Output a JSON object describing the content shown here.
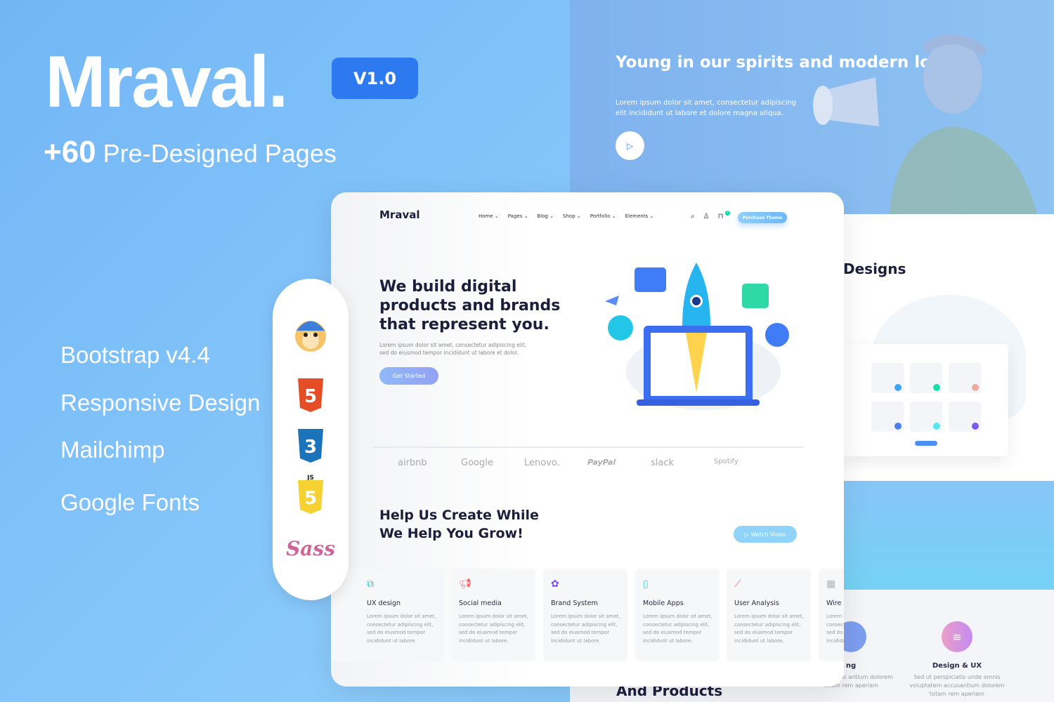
{
  "promo": {
    "title": "Mraval.",
    "version": "V1.0",
    "pages_count": "+60",
    "pages_label": "Pre-Designed Pages",
    "features": [
      "Bootstrap v4.4",
      "Responsive Design",
      "Mailchimp",
      "Google Fonts"
    ],
    "tech_icons": [
      "mailchimp-icon",
      "html5-icon",
      "css3-icon",
      "javascript-icon",
      "sass-icon"
    ],
    "sass_text": "Sass",
    "js_text": "JS"
  },
  "hero_right": {
    "title": "Young in our spirits and modern look.",
    "text": "Lorem ipsum dolor sit amet, consectetur adipiscing elit incididunt ut labore et dolore magna aliqua."
  },
  "designs_panel": {
    "title": "Designs",
    "dot_colors": [
      "#3fa2f7",
      "#18dfa9",
      "#f0a8a0",
      "#4d7df2",
      "#55e6f0",
      "#7b5af0"
    ]
  },
  "products": {
    "title": "And Products",
    "services": [
      {
        "title": "ng",
        "text": "s unde omnis\nantium dolorem\ntotam rem aperiam",
        "color": "#7d9ef0"
      },
      {
        "title": "Design & UX",
        "text": "Sed ut perspiciatis unde omnis voluptatem accusantium dolorem totam rem aperiam",
        "color": "#d18de0"
      }
    ]
  },
  "site": {
    "logo": "Mraval",
    "nav": [
      "Home",
      "Pages",
      "Blog",
      "Shop",
      "Portfolio",
      "Elements"
    ],
    "cart_count": "2",
    "purchase": "Purchase Theme",
    "hero_title": "We build digital products and brands that represent you.",
    "hero_text": "Lorem ipsum dolor sit amet, consectetur adipiscing elit, sed do eiusmod tempor incididunt ut labore et dolor.",
    "cta": "Get Started",
    "brands": [
      "airbnb",
      "Google",
      "Lenovo.",
      "PayPal",
      "slack",
      "Spotify"
    ],
    "help_title": "Help Us Create While We Help You Grow!",
    "watch": "Watch Video",
    "services": [
      {
        "title": "UX design",
        "icon": "layers-icon",
        "color": "#22c7d8"
      },
      {
        "title": "Social media",
        "icon": "megaphone-icon",
        "color": "#f26b6b"
      },
      {
        "title": "Brand System",
        "icon": "flower-icon",
        "color": "#7a4cf0"
      },
      {
        "title": "Mobile Apps",
        "icon": "mobile-icon",
        "color": "#34d6e6"
      },
      {
        "title": "User Analysis",
        "icon": "chart-icon",
        "color": "#f26b6b"
      },
      {
        "title": "Wire",
        "icon": "grid-icon",
        "color": "#f5a25c"
      }
    ],
    "service_text": "Lorem ipsum dolor sit amet,\nconsectetur adipiscing elit,\nsed do eiusmod tempor\nincididunt ut labore."
  }
}
